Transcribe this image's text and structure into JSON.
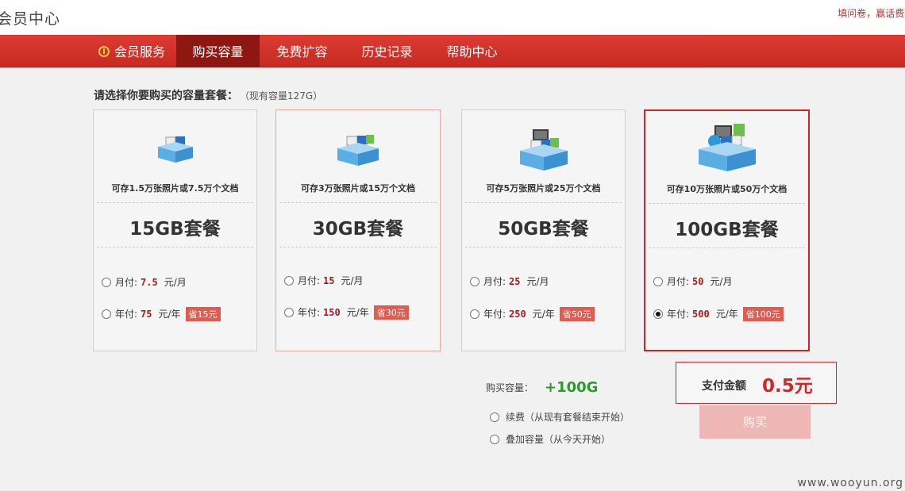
{
  "header": {
    "title": "会员中心",
    "promo": "填问卷，赢话费!"
  },
  "nav": {
    "items": [
      {
        "label": "会员服务"
      },
      {
        "label": "购买容量"
      },
      {
        "label": "免费扩容"
      },
      {
        "label": "历史记录"
      },
      {
        "label": "帮助中心"
      }
    ],
    "active_index": 1
  },
  "selection": {
    "title": "请选择你要购买的容量套餐：",
    "current_capacity": "（现有容量127G）"
  },
  "plans": [
    {
      "desc": "可存1.5万张照片或7.5万个文档",
      "name": "15GB套餐",
      "monthly": {
        "label": "月付:",
        "price": "7.5",
        "unit": "元/月"
      },
      "yearly": {
        "label": "年付:",
        "price": "75",
        "unit": "元/年",
        "save": "省15元"
      },
      "selected": "none"
    },
    {
      "desc": "可存3万张照片或15万个文档",
      "name": "30GB套餐",
      "monthly": {
        "label": "月付:",
        "price": "15",
        "unit": "元/月"
      },
      "yearly": {
        "label": "年付:",
        "price": "150",
        "unit": "元/年",
        "save": "省30元"
      },
      "selected": "none"
    },
    {
      "desc": "可存5万张照片或25万个文档",
      "name": "50GB套餐",
      "monthly": {
        "label": "月付:",
        "price": "25",
        "unit": "元/月"
      },
      "yearly": {
        "label": "年付:",
        "price": "250",
        "unit": "元/年",
        "save": "省50元"
      },
      "selected": "none"
    },
    {
      "desc": "可存10万张照片或50万个文档",
      "name": "100GB套餐",
      "monthly": {
        "label": "月付:",
        "price": "50",
        "unit": "元/月"
      },
      "yearly": {
        "label": "年付:",
        "price": "500",
        "unit": "元/年",
        "save": "省100元"
      },
      "selected": "yearly"
    }
  ],
  "purchase": {
    "capacity_label": "购买容量：",
    "capacity_value": "+100G",
    "renew_option": "续费（从现有套餐结束开始）",
    "add_option": "叠加容量（从今天开始）",
    "pay_label": "支付金额",
    "pay_amount": "0.5元",
    "buy_button": "购买"
  },
  "watermark": "www.wooyun.org",
  "colors": {
    "nav_red": "#d43128",
    "nav_active": "#8f1712",
    "price_red": "#a81c1c",
    "save_badge": "#e05c50",
    "capacity_green": "#2b9b2b",
    "buy_disabled": "#eeb7b5"
  }
}
